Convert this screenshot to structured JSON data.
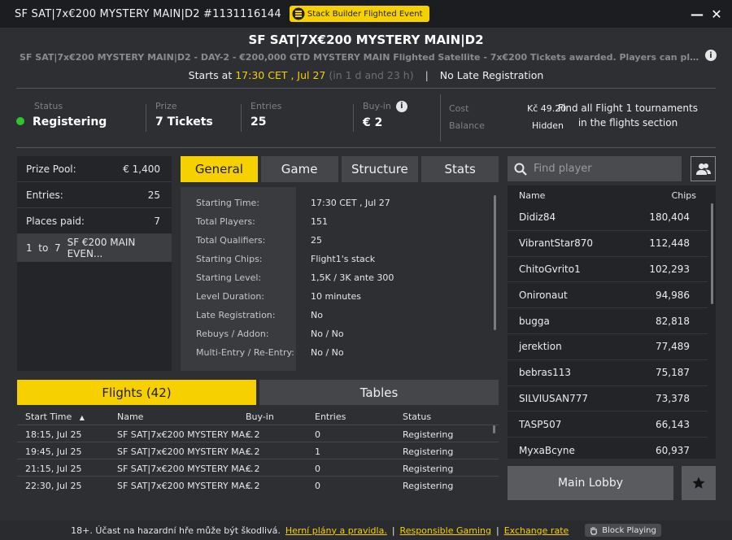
{
  "window": {
    "title": "SF SAT|7x€200 MYSTERY MAIN|D2 #1131116144",
    "badge": "Stack Builder Flighted Event",
    "badge_color": "#f7d000"
  },
  "header": {
    "title": "SF SAT|7X€200 MYSTERY MAIN|D2",
    "subtitle": "SF SAT|7x€200 MYSTERY MAIN|D2 - DAY-2 - €200,000 GTD MYSTERY MAIN Flighted Satellite - 7x€200 Tickets awarded. Players can play and qualify in multi...",
    "starts_prefix": "Starts at",
    "starts_time": "17:30 CET , Jul 27",
    "starts_rel": "(in 1 d and 23 h)",
    "late_reg": "No Late Registration"
  },
  "stats": {
    "status_label": "Status",
    "status_value": "Registering",
    "prize_label": "Prize",
    "prize_value": "7 Tickets",
    "entries_label": "Entries",
    "entries_value": "25",
    "buyin_label": "Buy-in",
    "buyin_value": "€ 2",
    "cost_label": "Cost",
    "cost_value": "Kč 49.20",
    "balance_label": "Balance",
    "balance_value": "Hidden",
    "find_text": "Find all Flight 1 tournaments in the flights section"
  },
  "prize_panel": {
    "rows": [
      {
        "label": "Prize Pool:",
        "value": "€ 1,400"
      },
      {
        "label": "Entries:",
        "value": "25"
      },
      {
        "label": "Places paid:",
        "value": "7"
      }
    ],
    "place_range": "1  to  7",
    "place_prize": "SF €200 MAIN EVEN..."
  },
  "tabs": [
    "General",
    "Game",
    "Structure",
    "Stats"
  ],
  "general": [
    {
      "label": "Starting Time:",
      "value": "17:30 CET , Jul 27"
    },
    {
      "label": "Total Players:",
      "value": "151"
    },
    {
      "label": "Total Qualifiers:",
      "value": "25"
    },
    {
      "label": "Starting Chips:",
      "value": "Flight1's stack"
    },
    {
      "label": "Starting Level:",
      "value": "1,5K / 3K ante 300"
    },
    {
      "label": "Level Duration:",
      "value": "10 minutes"
    },
    {
      "label": "Late Registration:",
      "value": "No"
    },
    {
      "label": "Rebuys / Addon:",
      "value": "No / No"
    },
    {
      "label": "Multi-Entry / Re-Entry:",
      "value": "No / No"
    }
  ],
  "search": {
    "placeholder": "Find player"
  },
  "players": {
    "col_name": "Name",
    "col_chips": "Chips",
    "rows": [
      {
        "name": "Didiz84",
        "chips": "180,404"
      },
      {
        "name": "VibrantStar870",
        "chips": "112,448"
      },
      {
        "name": "ChitoGvrito1",
        "chips": "102,293"
      },
      {
        "name": "Onironaut",
        "chips": "94,986"
      },
      {
        "name": "bugga",
        "chips": "82,818"
      },
      {
        "name": "jerektion",
        "chips": "77,489"
      },
      {
        "name": "bebras113",
        "chips": "75,187"
      },
      {
        "name": "SILVIUSAN777",
        "chips": "73,378"
      },
      {
        "name": "TASP507",
        "chips": "66,143"
      },
      {
        "name": "MyxaBcyne",
        "chips": "60,937"
      }
    ]
  },
  "flight_tabs": [
    "Flights (42)",
    "Tables"
  ],
  "flights": {
    "cols": [
      "Start Time",
      "Name",
      "Buy-in",
      "Entries",
      "Status"
    ],
    "sort_arrow": "▲",
    "rows": [
      [
        "18:15, Jul 25",
        "SF SAT|7x€200 MYSTERY MA...",
        "€ 2",
        "0",
        "Registering"
      ],
      [
        "19:45, Jul 25",
        "SF SAT|7x€200 MYSTERY MA...",
        "€ 2",
        "1",
        "Registering"
      ],
      [
        "21:15, Jul 25",
        "SF SAT|7x€200 MYSTERY MA...",
        "€ 2",
        "0",
        "Registering"
      ],
      [
        "22:30, Jul 25",
        "SF SAT|7x€200 MYSTERY MA...",
        "€ 2",
        "0",
        "Registering"
      ]
    ]
  },
  "buttons": {
    "main_lobby": "Main Lobby"
  },
  "footer": {
    "text": "18+. Účast na hazardní hře může být škodlivá.",
    "link1": "Herní plány a pravidla.",
    "link2": "Responsible Gaming",
    "link3": "Exchange rate",
    "sep": "|",
    "block": "Block Playing"
  }
}
